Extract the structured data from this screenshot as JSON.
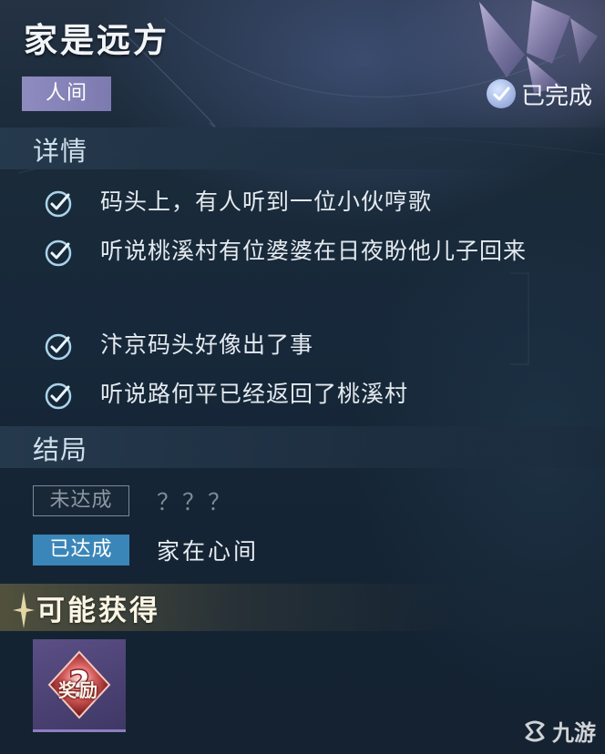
{
  "quest": {
    "title": "家是远方",
    "realm_tag": "人间",
    "status_text": "已完成",
    "status_icon": "check-badge-icon",
    "emblem_icon": "butterfly-emblem-icon"
  },
  "details": {
    "heading": "详情",
    "items": [
      {
        "text": "码头上，有人听到一位小伙哼歌",
        "done": true
      },
      {
        "text": "听说桃溪村有位婆婆在日夜盼他儿子回来",
        "done": true
      },
      {
        "text": "汴京码头好像出了事",
        "done": true
      },
      {
        "text": "听说路何平已经返回了桃溪村",
        "done": true
      }
    ]
  },
  "endings": {
    "heading": "结局",
    "items": [
      {
        "status": "未达成",
        "text": "？？？",
        "achieved": false
      },
      {
        "status": "已达成",
        "text": "家在心间",
        "achieved": true
      }
    ]
  },
  "rewards": {
    "heading": "可能获得",
    "items": [
      {
        "label": "奖励",
        "icon": "mystery-reward-icon"
      }
    ]
  },
  "watermark": {
    "text": "九游",
    "icon": "jiuyou-logo-icon"
  },
  "colors": {
    "realm_tag": "#8e8bbf",
    "achieved": "#3b86b8",
    "check": "#a9d3ea",
    "reward_frame": "#5b4f86"
  }
}
